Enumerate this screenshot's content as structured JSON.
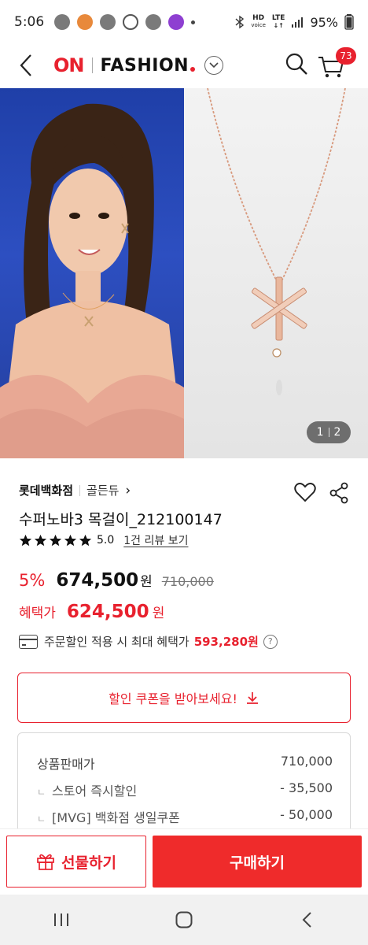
{
  "status_bar": {
    "time": "5:06",
    "hd_label": "HD",
    "voice_label": "voice",
    "lte_label": "LTE",
    "battery": "95%"
  },
  "header": {
    "logo_on": "ON",
    "logo_fashion": "FASHION",
    "cart_count": "73"
  },
  "gallery": {
    "current_page": "1",
    "total_pages": "2"
  },
  "product": {
    "store": "롯데백화점",
    "brand": "골든듀",
    "brand_chevron": "›",
    "name": "수퍼노바3 목걸이_212100147",
    "rating": "5.0",
    "star_count": 5,
    "review_link": "1건 리뷰 보기"
  },
  "price": {
    "discount_rate": "5%",
    "sale_price": "674,500",
    "won": "원",
    "original_price": "710,000",
    "benefit_label": "혜택가",
    "benefit_price": "624,500",
    "benefit_won": "원",
    "order_text": "주문할인 적용 시 최대 혜택가",
    "order_amount": "593,280원",
    "help": "?"
  },
  "coupon": {
    "label": "할인 쿠폰을 받아보세요!"
  },
  "price_breakdown": {
    "rows": [
      {
        "label": "상품판매가",
        "value": "710,000"
      },
      {
        "label": "스토어 즉시할인",
        "value": "- 35,500"
      },
      {
        "label": "[MVG] 백화점 생일쿠폰",
        "value": "- 50,000"
      }
    ]
  },
  "actions": {
    "gift": "선물하기",
    "buy": "구매하기"
  },
  "colors": {
    "accent": "#e8212e",
    "buy_button": "#ef2b2b"
  }
}
